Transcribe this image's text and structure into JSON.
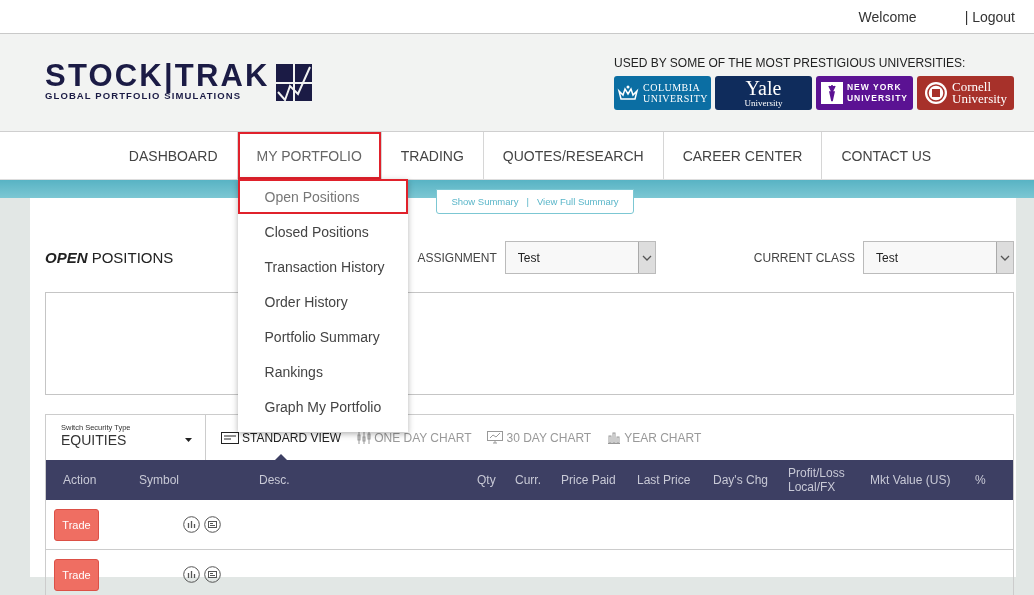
{
  "top_bar": {
    "welcome": "Welcome",
    "logout": "| Logout"
  },
  "header": {
    "logo": {
      "name": "STOCK|TRAK",
      "tagline": "GLOBAL PORTFOLIO SIMULATIONS"
    },
    "universities_caption": "USED BY SOME OF THE MOST PRESTIGIOUS UNIVERSITIES:",
    "universities": [
      {
        "kind": "crown",
        "lines": [
          "COLUMBIA",
          "UNIVERSITY"
        ],
        "color": "#0b6ea3"
      },
      {
        "kind": "plain",
        "lines": [
          "Yale",
          "University"
        ],
        "color": "#0f2c5c"
      },
      {
        "kind": "torch",
        "lines": [
          "NEW YORK",
          "UNIVERSITY"
        ],
        "color": "#5b1293"
      },
      {
        "kind": "seal",
        "lines": [
          "Cornell",
          "University"
        ],
        "color": "#a7312a"
      }
    ]
  },
  "nav": [
    {
      "label": "DASHBOARD",
      "selected": false
    },
    {
      "label": "MY PORTFOLIO",
      "selected": true
    },
    {
      "label": "TRADING",
      "selected": false
    },
    {
      "label": "QUOTES/RESEARCH",
      "selected": false
    },
    {
      "label": "CAREER CENTER",
      "selected": false
    },
    {
      "label": "CONTACT US",
      "selected": false
    }
  ],
  "portfolio_menu": [
    {
      "label": "Open Positions",
      "selected": true
    },
    {
      "label": "Closed Positions",
      "selected": false
    },
    {
      "label": "Transaction History",
      "selected": false
    },
    {
      "label": "Order History",
      "selected": false
    },
    {
      "label": "Portfolio Summary",
      "selected": false
    },
    {
      "label": "Rankings",
      "selected": false
    },
    {
      "label": "Graph My Portfolio",
      "selected": false
    }
  ],
  "summary_links": {
    "show": "Show Summary",
    "separator": "|",
    "full": "View Full Summary"
  },
  "page_title": "**OPEN** POSITIONS",
  "filters": [
    {
      "label": "ASSIGNMENT",
      "value": "Test"
    },
    {
      "label": "CURRENT CLASS",
      "value": "Test"
    }
  ],
  "security_type": {
    "label": "Switch Security Type",
    "value": "EQUITIES"
  },
  "views": [
    {
      "kind": "standard",
      "label": "STANDARD VIEW",
      "selected": true
    },
    {
      "kind": "one_day",
      "label": "ONE DAY CHART",
      "selected": false
    },
    {
      "kind": "thirty_day",
      "label": "30 DAY CHART",
      "selected": false
    },
    {
      "kind": "year",
      "label": "YEAR CHART",
      "selected": false
    }
  ],
  "table": {
    "columns": [
      "Action",
      "Symbol",
      "Desc.",
      "Qty",
      "Curr.",
      "Price Paid",
      "Last Price",
      "Day's Chg",
      "Profit/Loss Local/FX",
      "Mkt Value (US)",
      "%"
    ],
    "rows": [
      {
        "action": "Trade"
      },
      {
        "action": "Trade"
      }
    ]
  }
}
